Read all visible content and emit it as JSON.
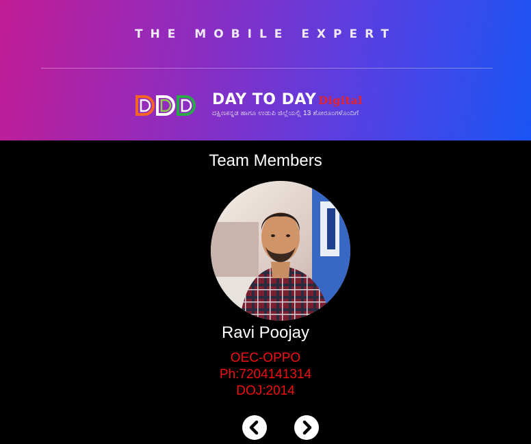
{
  "header": {
    "tagline": "THE MOBILE EXPERT",
    "logo": {
      "title": "DAY TO DAY",
      "accent": "Digital",
      "subtitle": "ದಕ್ಷಿಣಕನ್ನಡ ಹಾಗೂ ಉಡುಪಿ ಜಿಲ್ಲೆಯಲ್ಲಿ 13 ಶೋರೂಂಗಳೊಂದಿಗೆ"
    }
  },
  "team": {
    "title": "Team Members",
    "member": {
      "name": "Ravi Poojay",
      "role": "OEC-OPPO",
      "phone": "Ph:7204141314",
      "doj": "DOJ:2014"
    }
  },
  "nav": {
    "prev_icon": "chevron-left-icon",
    "next_icon": "chevron-right-icon"
  },
  "colors": {
    "header_gradient_start": "#c21d95",
    "header_gradient_end": "#1a55f5",
    "detail_text": "#f01010",
    "logo_accent": "#e8242a"
  }
}
